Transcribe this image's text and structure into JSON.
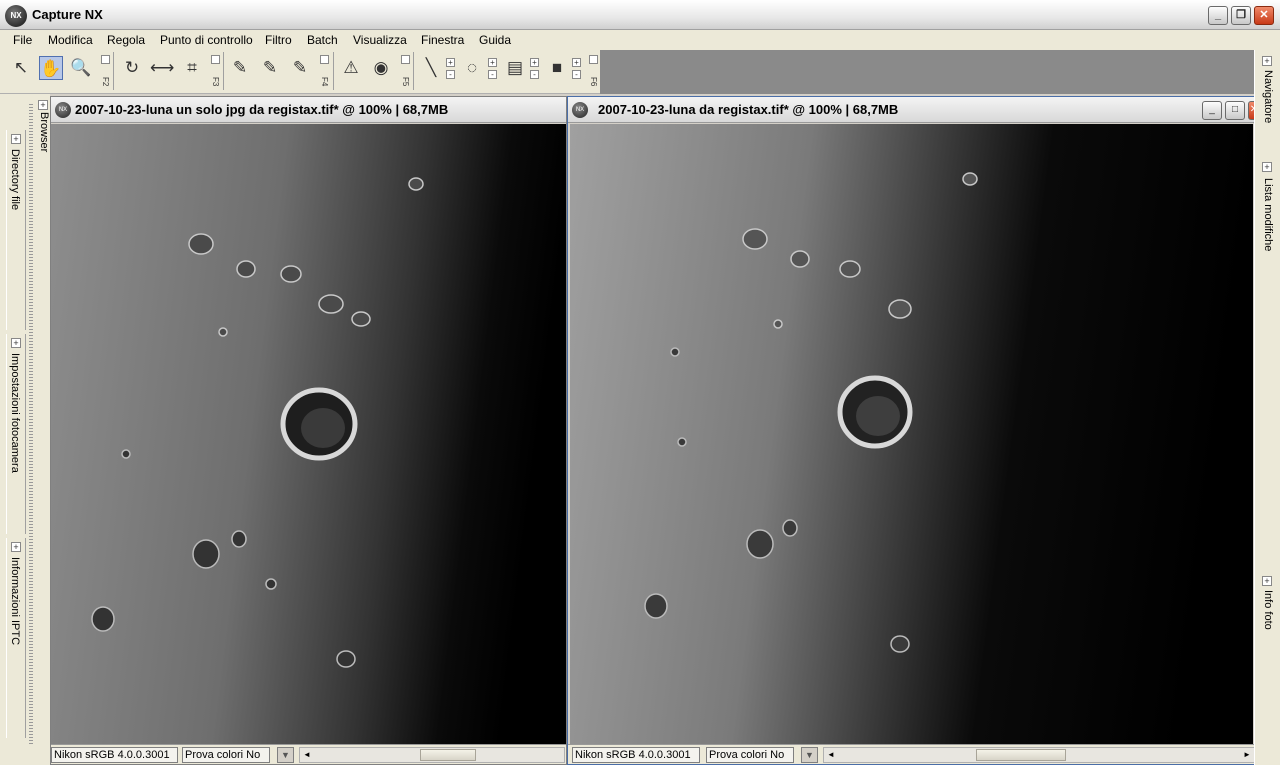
{
  "app": {
    "title": "Capture NX",
    "logo_text": "NX",
    "window_controls": {
      "minimize": "_",
      "maximize": "❐",
      "close": "✕"
    }
  },
  "menu": [
    "File",
    "Modifica",
    "Regola",
    "Punto di controllo",
    "Filtro",
    "Batch",
    "Visualizza",
    "Finestra",
    "Guida"
  ],
  "toolbar": {
    "tools": [
      {
        "name": "direct-select",
        "icon": "arrow-cursor-icon",
        "glyph": "↖"
      },
      {
        "name": "hand",
        "icon": "hand-icon",
        "glyph": "✋",
        "active": true
      },
      {
        "name": "zoom",
        "icon": "magnifier-icon",
        "glyph": "🔍"
      },
      {
        "name": "rotate",
        "icon": "rotate-icon",
        "glyph": "↻"
      },
      {
        "name": "straighten",
        "icon": "straighten-icon",
        "glyph": "⟷"
      },
      {
        "name": "crop",
        "icon": "crop-icon",
        "glyph": "⌗"
      },
      {
        "name": "black-point",
        "icon": "black-control-point-icon",
        "glyph": "✎"
      },
      {
        "name": "white-point",
        "icon": "white-control-point-icon",
        "glyph": "✎"
      },
      {
        "name": "neutral-point",
        "icon": "neutral-control-point-icon",
        "glyph": "✎"
      },
      {
        "name": "red-eye",
        "icon": "red-eye-icon",
        "glyph": "⚠"
      },
      {
        "name": "eye",
        "icon": "eye-icon",
        "glyph": "◉"
      },
      {
        "name": "brush",
        "icon": "selection-brush-icon",
        "glyph": "╲"
      },
      {
        "name": "lasso",
        "icon": "lasso-icon",
        "glyph": "◌"
      },
      {
        "name": "gradient",
        "icon": "gradient-icon",
        "glyph": "▤"
      },
      {
        "name": "fill",
        "icon": "fill-remove-icon",
        "glyph": "■"
      }
    ],
    "fkeys": [
      "F2",
      "F3",
      "F4",
      "F5",
      "F6"
    ],
    "plus": "+",
    "minus": "-"
  },
  "left_panel": {
    "browser_tab": "Browser",
    "sections": [
      "Directory file",
      "Impostazioni fotocamera",
      "Informazioni IPTC"
    ],
    "plus": "+"
  },
  "right_panel": {
    "sections": [
      "Navigatore",
      "Lista modifiche",
      "Info foto"
    ],
    "plus": "+"
  },
  "documents": [
    {
      "title": "2007-10-23-luna un solo jpg da registax.tif* @ 100% | 68,7MB",
      "icon_text": "NX",
      "profile": "Nikon sRGB 4.0.0.3001",
      "softproof": "Prova colori No",
      "drop_arrow": "▼",
      "scroll_left": "◄",
      "scroll_right": "►"
    },
    {
      "title": "2007-10-23-luna da registax.tif* @ 100% | 68,7MB",
      "icon_text": "NX",
      "profile": "Nikon sRGB 4.0.0.3001",
      "softproof": "Prova colori No",
      "drop_arrow": "▼",
      "scroll_left": "◄",
      "scroll_right": "►",
      "controls": {
        "minimize": "_",
        "maximize": "□",
        "close": "✕"
      }
    }
  ]
}
